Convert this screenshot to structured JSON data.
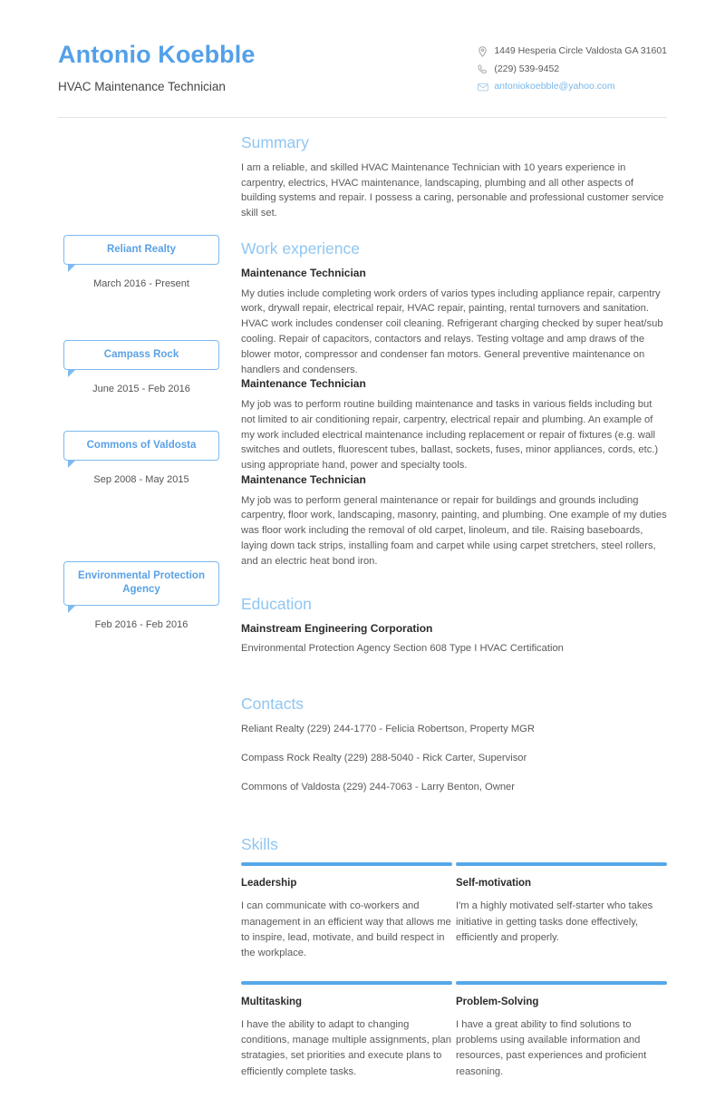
{
  "header": {
    "full_name": "Antonio Koebble",
    "job_title": "HVAC Maintenance Technician",
    "contacts": [
      {
        "icon": "location-pin-icon",
        "text": "1449 Hesperia Circle Valdosta GA 31601",
        "kind": "address"
      },
      {
        "icon": "phone-icon",
        "text": "(229) 539-9452",
        "kind": "phone"
      },
      {
        "icon": "envelope-icon",
        "text": "antoniokoebble@yahoo.com",
        "kind": "email"
      }
    ]
  },
  "colors": {
    "name_blue": "#53A0E8",
    "heading_blue": "#8FC6F2",
    "accent_blue": "#56A8E8",
    "bubble_border": "#7DBAF0",
    "bubble_text": "#5AA2E6",
    "email_link": "#77B7EA",
    "body_text": "#5A5A5A",
    "divider": "#E3E3E3"
  },
  "sections": {
    "summary": {
      "title": "Summary",
      "text": "I am a reliable, and skilled HVAC Maintenance Technician with 10 years experience in carpentry, electrics, HVAC maintenance, landscaping, plumbing and all other aspects of building systems and repair. I possess a caring, personable and professional customer service skill set."
    },
    "work_experience": {
      "title": "Work experience",
      "entries": [
        {
          "company": "Reliant Realty",
          "dates": "March 2016 - Present",
          "role": "Maintenance Technician",
          "description": "My duties include completing work orders of varios types including appliance repair, carpentry work, drywall repair, electrical repair, HVAC repair, painting, rental turnovers and sanitation. HVAC work includes condenser coil cleaning. Refrigerant charging checked by super heat/sub cooling. Repair of capacitors, contactors and relays. Testing voltage and amp draws of the blower motor, compressor and condenser fan motors. General preventive maintenance on handlers and condensers."
        },
        {
          "company": "Campass Rock",
          "dates": "June 2015 - Feb 2016",
          "role": "Maintenance Technician",
          "description": "My job was to perform routine building maintenance and tasks in various fields including but not limited to air conditioning repair, carpentry, electrical repair and plumbing. An example of my work included electrical maintenance including replacement or repair of fixtures (e.g. wall switches and outlets, fluorescent tubes, ballast, sockets, fuses, minor appliances, cords, etc.) using appropriate hand, power and specialty tools."
        },
        {
          "company": "Commons of Valdosta",
          "dates": "Sep 2008 - May 2015",
          "role": "Maintenance Technician",
          "description": "My job was to perform general maintenance or repair for buildings and grounds including carpentry, floor work, landscaping, masonry, painting, and plumbing. One example of my duties was floor work including the removal of old carpet, linoleum, and tile. Raising baseboards, laying down tack strips, installing foam and carpet while using carpet stretchers, steel rollers, and an electric heat bond iron."
        }
      ]
    },
    "education": {
      "title": "Education",
      "entries": [
        {
          "organization": "Environmental Protection Agency",
          "dates": "Feb 2016 - Feb 2016",
          "school": "Mainstream Engineering Corporation",
          "description": "Environmental Protection Agency Section 608 Type I HVAC Certification"
        }
      ]
    },
    "contacts": {
      "title": "Contacts",
      "lines": [
        "Reliant Realty (229) 244-1770 - Felicia Robertson, Property MGR",
        "Compass Rock Realty (229) 288-5040 - Rick Carter, Supervisor",
        "Commons of Valdosta (229) 244-7063 - Larry Benton, Owner"
      ]
    },
    "skills": {
      "title": "Skills",
      "items": [
        {
          "name": "Leadership",
          "description": "I can communicate with co-workers and management in an efficient way that allows me to inspire, lead, motivate, and build respect in the workplace."
        },
        {
          "name": "Self-motivation",
          "description": "I'm a highly motivated self-starter who takes initiative in getting tasks done effectively, efficiently and properly."
        },
        {
          "name": "Multitasking",
          "description": "I have the ability to adapt to changing conditions, manage multiple assignments, plan stratagies, set priorities and execute plans to efficiently complete tasks."
        },
        {
          "name": "Problem-Solving",
          "description": "I have a great ability to find solutions to problems using available information and resources, past experiences and proficient reasoning."
        }
      ]
    }
  }
}
